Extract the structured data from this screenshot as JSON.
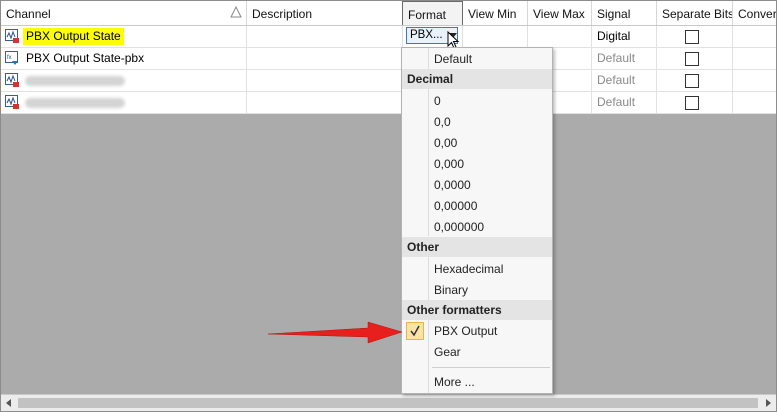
{
  "header": {
    "columns": [
      "Channel",
      "Description",
      "Format",
      "View Min",
      "View Max",
      "Signal",
      "Separate Bits",
      "Conver"
    ]
  },
  "rows": [
    {
      "name": "PBX Output State",
      "highlighted": true,
      "format": "PBX...",
      "signal": "Digital"
    },
    {
      "name": "PBX Output State-pbx",
      "highlighted": false,
      "format": "",
      "signal": "Default"
    },
    {
      "name": "",
      "highlighted": false,
      "format": "",
      "signal": "Default"
    },
    {
      "name": "",
      "highlighted": false,
      "format": "",
      "signal": "Default"
    }
  ],
  "menu": {
    "default": "Default",
    "section_decimal": "Decimal",
    "decimal_items": [
      "0",
      "0,0",
      "0,00",
      "0,000",
      "0,0000",
      "0,00000",
      "0,000000"
    ],
    "section_other": "Other",
    "other_items": [
      "Hexadecimal",
      "Binary"
    ],
    "section_formatters": "Other formatters",
    "formatter_items": [
      "PBX Output",
      "Gear"
    ],
    "more": "More ..."
  },
  "colors": {
    "highlight": "#fbfb0a",
    "arrow": "#e8201d",
    "check_bg": "#fde3a6",
    "background": "#ababab"
  }
}
